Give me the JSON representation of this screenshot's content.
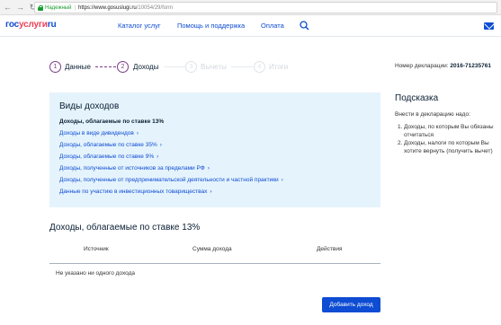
{
  "browser": {
    "secure_label": "Надежный",
    "url_host": "https://www.gosuslugi.ru",
    "url_path": "/10054/29/form"
  },
  "header": {
    "logo_part1": "гос",
    "logo_part2": "услуги",
    "logo_part3": "ru",
    "nav": [
      "Каталог услуг",
      "Помощь и поддержка",
      "Оплата"
    ]
  },
  "stepper": {
    "steps": [
      {
        "num": "1",
        "label": "Данные",
        "state": "done"
      },
      {
        "num": "2",
        "label": "Доходы",
        "state": "current"
      },
      {
        "num": "3",
        "label": "Вычеты",
        "state": "inactive"
      },
      {
        "num": "4",
        "label": "Итоги",
        "state": "inactive"
      }
    ],
    "declaration_label": "Номер декларации:",
    "declaration_number": "2016-71235761"
  },
  "income_types": {
    "title": "Виды доходов",
    "current": "Доходы, облагаемые по ставке 13%",
    "links": [
      "Доходы в виде дивидендов",
      "Доходы, облагаемые по ставке 35%",
      "Доходы, облагаемые по ставке 9%",
      "Доходы, полученные от источников за пределами РФ",
      "Доходы, полученные от предпринимательской деятельности и частной практики",
      "Данные по участию в инвестиционных товариществах"
    ]
  },
  "hint": {
    "title": "Подсказка",
    "intro": "Внести в декларацию надо:",
    "items": [
      "Доходы, по которым Вы обязаны отчитаться",
      "Доходы, налоги по которым Вы хотите вернуть (получить вычет)"
    ]
  },
  "income_section": {
    "title": "Доходы, облагаемые по ставке 13%",
    "columns": [
      "Источник",
      "Сумма дохода",
      "Действия"
    ],
    "empty_text": "Не указано ни одного дохода",
    "add_button": "Добавить доход"
  },
  "colors": {
    "brand_blue": "#0d4cd3",
    "brand_red": "#ee3f58",
    "step_accent": "#7d3c8a",
    "panel_bg": "#e5f3fc"
  }
}
